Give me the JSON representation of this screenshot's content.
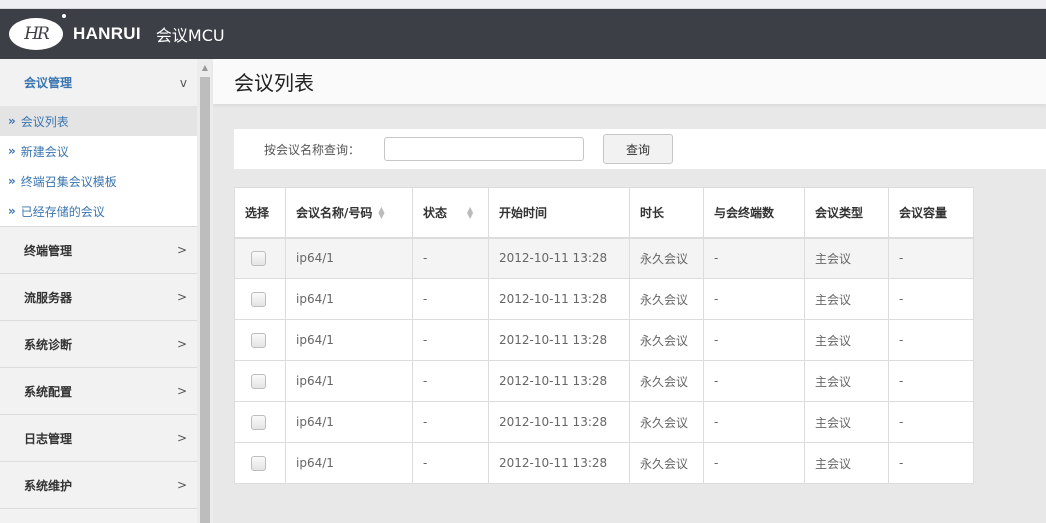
{
  "header": {
    "logo_text": "HR",
    "brand": "HANRUI",
    "product": "会议MCU"
  },
  "sidebar": {
    "groups": [
      {
        "label": "会议管理",
        "chevron": "v",
        "expanded": true,
        "items": [
          {
            "label": "会议列表",
            "selected": true
          },
          {
            "label": "新建会议"
          },
          {
            "label": "终端召集会议模板"
          },
          {
            "label": "已经存储的会议"
          }
        ]
      },
      {
        "label": "终端管理",
        "chevron": ">"
      },
      {
        "label": "流服务器",
        "chevron": ">"
      },
      {
        "label": "系统诊断",
        "chevron": ">"
      },
      {
        "label": "系统配置",
        "chevron": ">"
      },
      {
        "label": "日志管理",
        "chevron": ">"
      },
      {
        "label": "系统维护",
        "chevron": ">"
      }
    ],
    "item_prefix": "»"
  },
  "main": {
    "title": "会议列表",
    "filter": {
      "label": "按会议名称查询：",
      "value": "",
      "button": "查询"
    },
    "table": {
      "columns": [
        "选择",
        "会议名称/号码",
        "状态",
        "开始时间",
        "时长",
        "与会终端数",
        "会议类型",
        "会议容量"
      ],
      "rows": [
        [
          "ip64/1",
          "-",
          "2012-10-11 13:28",
          "永久会议",
          "-",
          "主会议",
          "-"
        ],
        [
          "ip64/1",
          "-",
          "2012-10-11 13:28",
          "永久会议",
          "-",
          "主会议",
          "-"
        ],
        [
          "ip64/1",
          "-",
          "2012-10-11 13:28",
          "永久会议",
          "-",
          "主会议",
          "-"
        ],
        [
          "ip64/1",
          "-",
          "2012-10-11 13:28",
          "永久会议",
          "-",
          "主会议",
          "-"
        ],
        [
          "ip64/1",
          "-",
          "2012-10-11 13:28",
          "永久会议",
          "-",
          "主会议",
          "-"
        ],
        [
          "ip64/1",
          "-",
          "2012-10-11 13:28",
          "永久会议",
          "-",
          "主会议",
          "-"
        ]
      ]
    }
  }
}
